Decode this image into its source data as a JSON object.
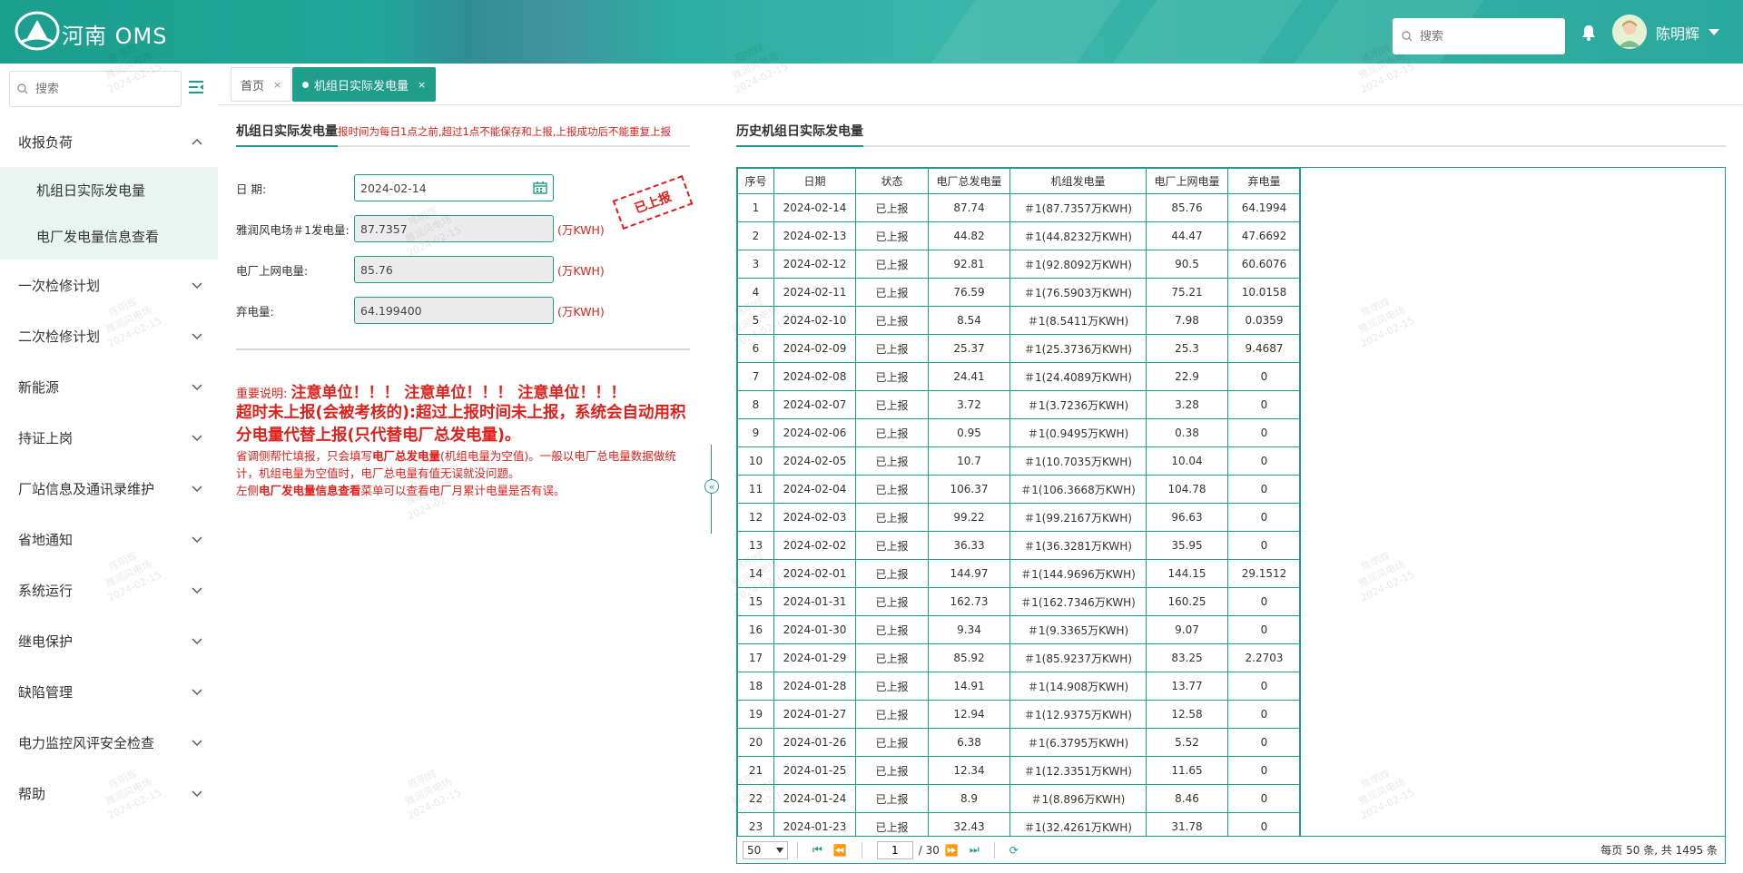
{
  "header": {
    "app_title": "河南 OMS",
    "search_placeholder": "搜索",
    "username": "陈明辉"
  },
  "sidebar": {
    "search_placeholder": "搜索",
    "groups": [
      {
        "label": "收报负荷",
        "expanded": true,
        "children": [
          "机组日实际发电量",
          "电厂发电量信息查看"
        ]
      },
      {
        "label": "一次检修计划"
      },
      {
        "label": "二次检修计划"
      },
      {
        "label": "新能源"
      },
      {
        "label": "持证上岗"
      },
      {
        "label": "厂站信息及通讯录维护"
      },
      {
        "label": "省地通知"
      },
      {
        "label": "系统运行"
      },
      {
        "label": "继电保护"
      },
      {
        "label": "缺陷管理"
      },
      {
        "label": "电力监控风评安全检查"
      },
      {
        "label": "帮助"
      }
    ]
  },
  "tabs": [
    {
      "label": "首页",
      "close": "×"
    },
    {
      "label": "机组日实际发电量",
      "close": "×",
      "active": true
    }
  ],
  "form": {
    "title": "机组日实际发电量",
    "hint": "报时间为每日1点之前,超过1点不能保存和上报,上报成功后不能重复上报",
    "date_label": "日  期:",
    "date_value": "2024-02-14",
    "unit_label": "雅润风电场＃1发电量:",
    "unit_value": "87.7357",
    "grid_label": "电厂上网电量:",
    "grid_value": "85.76",
    "waste_label": "弃电量:",
    "waste_value": "64.199400",
    "unit_suffix": "(万KWH)",
    "stamp": "已上报"
  },
  "notice": {
    "prefix": "重要说明: ",
    "attention": "注意单位！！！ 注意单位！！！ 注意单位！！！",
    "line2": "超时未上报(会被考核的):超过上报时间未上报，系统会自动用积分电量代替上报(只代替电厂总发电量)。",
    "line3a": "省调侧帮忙填报，只会填写",
    "line3b": "电厂总发电量",
    "line3c": "(机组电量为空值)。一般以电厂总电量数据做统计，机组电量为空值时，电厂总电量有值无误就没问题。",
    "line4a": "左侧",
    "line4b": "电厂发电量信息查看",
    "line4c": "菜单可以查看电厂月累计电量是否有误。"
  },
  "history": {
    "title": "历史机组日实际发电量",
    "columns": [
      "序号",
      "日期",
      "状态",
      "电厂总发电量",
      "机组发电量",
      "电厂上网电量",
      "弃电量"
    ],
    "rows": [
      [
        "1",
        "2024-02-14",
        "已上报",
        "87.74",
        "＃1(87.7357万KWH)",
        "85.76",
        "64.1994"
      ],
      [
        "2",
        "2024-02-13",
        "已上报",
        "44.82",
        "＃1(44.8232万KWH)",
        "44.47",
        "47.6692"
      ],
      [
        "3",
        "2024-02-12",
        "已上报",
        "92.81",
        "＃1(92.8092万KWH)",
        "90.5",
        "60.6076"
      ],
      [
        "4",
        "2024-02-11",
        "已上报",
        "76.59",
        "＃1(76.5903万KWH)",
        "75.21",
        "10.0158"
      ],
      [
        "5",
        "2024-02-10",
        "已上报",
        "8.54",
        "＃1(8.5411万KWH)",
        "7.98",
        "0.0359"
      ],
      [
        "6",
        "2024-02-09",
        "已上报",
        "25.37",
        "＃1(25.3736万KWH)",
        "25.3",
        "9.4687"
      ],
      [
        "7",
        "2024-02-08",
        "已上报",
        "24.41",
        "＃1(24.4089万KWH)",
        "22.9",
        "0"
      ],
      [
        "8",
        "2024-02-07",
        "已上报",
        "3.72",
        "＃1(3.7236万KWH)",
        "3.28",
        "0"
      ],
      [
        "9",
        "2024-02-06",
        "已上报",
        "0.95",
        "＃1(0.9495万KWH)",
        "0.38",
        "0"
      ],
      [
        "10",
        "2024-02-05",
        "已上报",
        "10.7",
        "＃1(10.7035万KWH)",
        "10.04",
        "0"
      ],
      [
        "11",
        "2024-02-04",
        "已上报",
        "106.37",
        "＃1(106.3668万KWH)",
        "104.78",
        "0"
      ],
      [
        "12",
        "2024-02-03",
        "已上报",
        "99.22",
        "＃1(99.2167万KWH)",
        "96.63",
        "0"
      ],
      [
        "13",
        "2024-02-02",
        "已上报",
        "36.33",
        "＃1(36.3281万KWH)",
        "35.95",
        "0"
      ],
      [
        "14",
        "2024-02-01",
        "已上报",
        "144.97",
        "＃1(144.9696万KWH)",
        "144.15",
        "29.1512"
      ],
      [
        "15",
        "2024-01-31",
        "已上报",
        "162.73",
        "＃1(162.7346万KWH)",
        "160.25",
        "0"
      ],
      [
        "16",
        "2024-01-30",
        "已上报",
        "9.34",
        "＃1(9.3365万KWH)",
        "9.07",
        "0"
      ],
      [
        "17",
        "2024-01-29",
        "已上报",
        "85.92",
        "＃1(85.9237万KWH)",
        "83.25",
        "2.2703"
      ],
      [
        "18",
        "2024-01-28",
        "已上报",
        "14.91",
        "＃1(14.908万KWH)",
        "13.77",
        "0"
      ],
      [
        "19",
        "2024-01-27",
        "已上报",
        "12.94",
        "＃1(12.9375万KWH)",
        "12.58",
        "0"
      ],
      [
        "20",
        "2024-01-26",
        "已上报",
        "6.38",
        "＃1(6.3795万KWH)",
        "5.52",
        "0"
      ],
      [
        "21",
        "2024-01-25",
        "已上报",
        "12.34",
        "＃1(12.3351万KWH)",
        "11.65",
        "0"
      ],
      [
        "22",
        "2024-01-24",
        "已上报",
        "8.9",
        "＃1(8.896万KWH)",
        "8.46",
        "0"
      ],
      [
        "23",
        "2024-01-23",
        "已上报",
        "32.43",
        "＃1(32.4261万KWH)",
        "31.78",
        "0"
      ]
    ]
  },
  "pager": {
    "page_size": "50",
    "page": "1",
    "total_pages": "/ 30",
    "info": "每页 50 条, 共 1495 条"
  },
  "watermark": {
    "name": "陈明辉",
    "site": "雅润风电场",
    "date": "2024-02-15"
  },
  "colors": {
    "accent": "#1f9e8c",
    "warning": "#e0211b"
  }
}
